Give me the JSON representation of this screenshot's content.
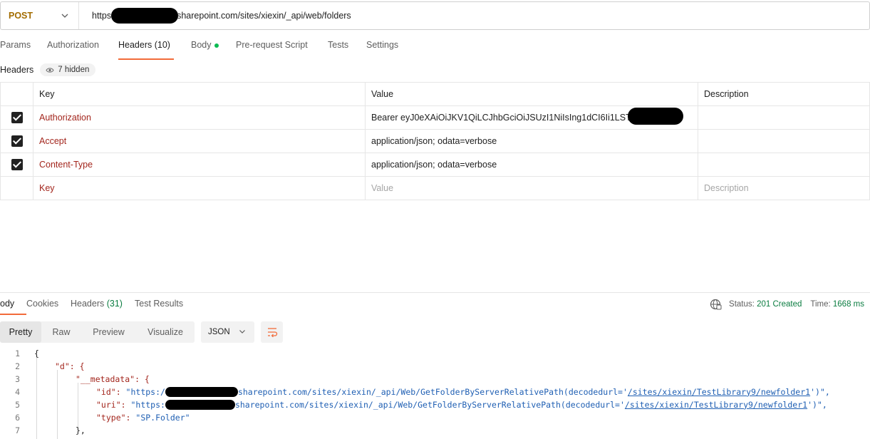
{
  "request": {
    "method": "POST",
    "url_prefix": "https",
    "url_suffix": "sharepoint.com/sites/xiexin/_api/web/folders"
  },
  "request_tabs": [
    {
      "label": "Params"
    },
    {
      "label": "Authorization"
    },
    {
      "label": "Headers (10)"
    },
    {
      "label": "Body"
    },
    {
      "label": "Pre-request Script"
    },
    {
      "label": "Tests"
    },
    {
      "label": "Settings"
    }
  ],
  "headers_section": {
    "title": "Headers",
    "hidden_label": "7 hidden"
  },
  "table": {
    "columns": [
      "Key",
      "Value",
      "Description"
    ],
    "rows": [
      {
        "key": "Authorization",
        "value": "Bearer eyJ0eXAiOiJKV1QiLCJhbGciOiJSUzI1NiIsIng1dCI6Ii1LST"
      },
      {
        "key": "Accept",
        "value": "application/json; odata=verbose"
      },
      {
        "key": "Content-Type",
        "value": "application/json; odata=verbose"
      }
    ],
    "placeholders": {
      "key": "Key",
      "value": "Value",
      "description": "Description"
    }
  },
  "response_tabs": [
    {
      "label": "ody"
    },
    {
      "label": "Cookies"
    },
    {
      "label": "Headers",
      "count": "(31)"
    },
    {
      "label": "Test Results"
    }
  ],
  "status": {
    "status_label": "Status:",
    "status_value": "201 Created",
    "time_label": "Time:",
    "time_value": "1668 ms"
  },
  "view_modes": [
    "Pretty",
    "Raw",
    "Preview",
    "Visualize"
  ],
  "format": "JSON",
  "colors": {
    "accent": "#f26b3a",
    "method": "#a36c00",
    "success": "#0b7d41",
    "body_dot": "#0cbb52"
  },
  "code_lines": [
    {
      "num": "1",
      "text": "{"
    },
    {
      "num": "2",
      "text": "\"d\": {"
    },
    {
      "num": "3",
      "text": "\"__metadata\": {"
    },
    {
      "num": "4",
      "key": "\"id\": ",
      "pre": "\"https:/",
      "post": "sharepoint.com/sites/xiexin/_api/Web/GetFolderByServerRelativePath(decodedurl='",
      "link": "/sites/xiexin/TestLibrary9/newfolder1",
      "end": "')\","
    },
    {
      "num": "5",
      "key": "\"uri\": ",
      "pre": "\"https:",
      "post": "sharepoint.com/sites/xiexin/_api/Web/GetFolderByServerRelativePath(decodedurl='",
      "link": "/sites/xiexin/TestLibrary9/newfolder1",
      "end": "')\","
    },
    {
      "num": "6",
      "key": "\"type\": ",
      "value": "\"SP.Folder\""
    },
    {
      "num": "7",
      "text": "},"
    }
  ]
}
